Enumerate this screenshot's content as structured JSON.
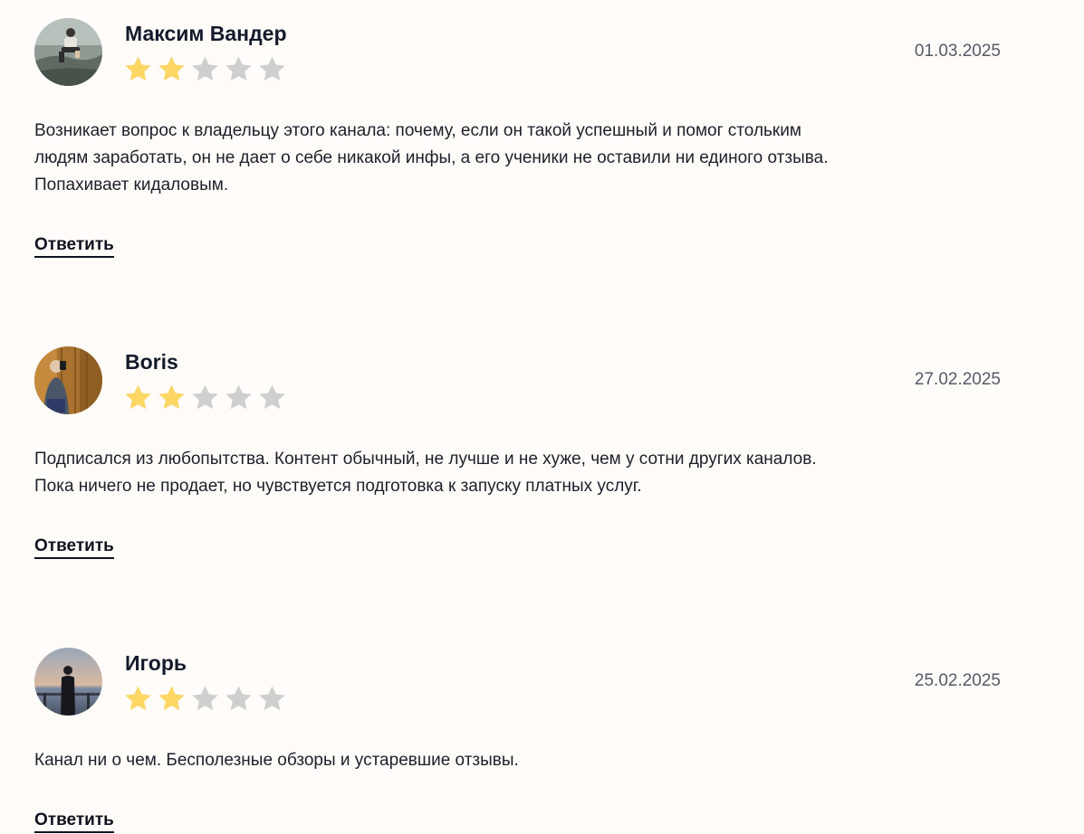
{
  "colors": {
    "background": "#fffcf9",
    "star_filled": "#fdd664",
    "star_empty": "#cfcfcf",
    "author": "#141a2b",
    "date": "#555a66"
  },
  "reviews": [
    {
      "author": "Максим Вандер",
      "date": "01.03.2025",
      "rating": 2,
      "max_rating": 5,
      "text_lines": [
        "Возникает вопрос к владельцу этого канала: почему, если он такой успешный и помог стольким",
        "людям заработать, он не дает о себе никакой инфы, а его ученики не оставили ни единого отзыва.",
        "Попахивает кидаловым."
      ],
      "reply_label": "Ответить",
      "avatar": "photo-man-sitting-on-rock"
    },
    {
      "author": "Boris",
      "date": "27.02.2025",
      "rating": 2,
      "max_rating": 5,
      "text_lines": [
        "Подписался из любопытства. Контент обычный, не лучше и не хуже, чем у сотни других каналов.",
        "Пока ничего не продает, но чувствуется подготовка к запуску платных услуг."
      ],
      "reply_label": "Ответить",
      "avatar": "photo-man-mirror-selfie"
    },
    {
      "author": "Игорь",
      "date": "25.02.2025",
      "rating": 2,
      "max_rating": 5,
      "text_lines": [
        "Канал ни о чем. Бесполезные обзоры и устаревшие отзывы."
      ],
      "reply_label": "Ответить",
      "avatar": "photo-man-at-seaside-sunset"
    }
  ]
}
